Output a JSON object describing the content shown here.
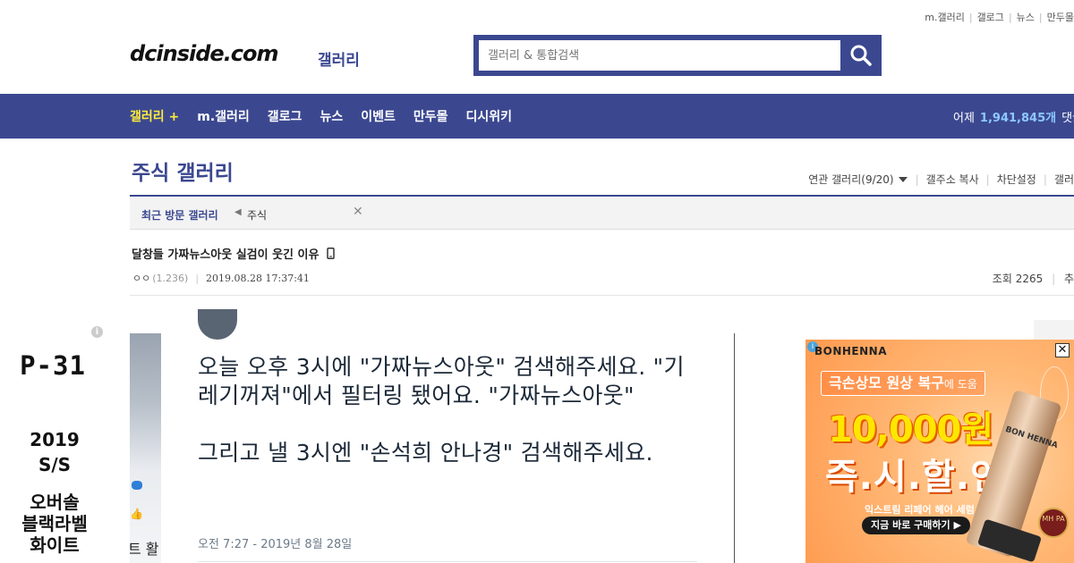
{
  "util_links": [
    "m.갤러리",
    "갤로그",
    "뉴스",
    "만두몰"
  ],
  "logo": {
    "text": "dcinside.com",
    "sub": "갤러리"
  },
  "search": {
    "placeholder": "갤러리 & 통합검색"
  },
  "nav": {
    "items": [
      "갤러리 +",
      "m.갤러리",
      "갤로그",
      "뉴스",
      "이벤트",
      "만두몰",
      "디시위키"
    ],
    "visits_label": "어제",
    "visits_count": "1,941,845개",
    "visits_suffix": "댓글"
  },
  "gallery": {
    "title": "주식 갤러리",
    "tools": [
      "연관 갤러리(9/20)",
      "갤주소 복사",
      "차단설정",
      "갤러"
    ]
  },
  "recent": {
    "label": "최근 방문 갤러리",
    "item": "주식"
  },
  "post": {
    "title": "달창들 가짜뉴스아웃 실검이 웃긴 이유",
    "author": "ㅇㅇ",
    "ip": "(1.236)",
    "date": "2019.08.28 17:37:41",
    "views_label": "조회",
    "views": "2265",
    "rec_label": "추"
  },
  "left_ad": {
    "code": "P-31",
    "season_line1": "2019",
    "season_line2": "S/S",
    "name_line1": "오버솔",
    "name_line2": "블랙라벨",
    "name_line3": "화이트"
  },
  "sliver_text": "트 활",
  "tweet": {
    "text": "오늘 오후 3시에 \"가짜뉴스아웃\" 검색해주세요. \"기레기꺼져\"에서 필터링 됐어요. \"가짜뉴스아웃\"\n\n그리고 낼 3시엔 \"손석희 안나경\" 검색해주세요.",
    "time": "오전 7:27 - 2019년 8월 28일"
  },
  "right_ad": {
    "brand": "BONHENNA",
    "headline": "극손상모 원상 복구",
    "headline_small": "에 도움",
    "price": "10,000원",
    "sale": "즉.시.할.인!",
    "sub": "익스트림 리페어 헤어 세럼",
    "cta": "지금 바로 구매하기 ▶",
    "product_label": "BON HENNA",
    "seal": "MH PA"
  },
  "colors": {
    "brand": "#3b4890",
    "highlight": "#ffec3b",
    "visits": "#8ec8ff"
  },
  "icons": [
    "search-icon",
    "caret-down-icon",
    "mobile-icon",
    "close-icon",
    "info-icon",
    "arrow-left-icon"
  ]
}
